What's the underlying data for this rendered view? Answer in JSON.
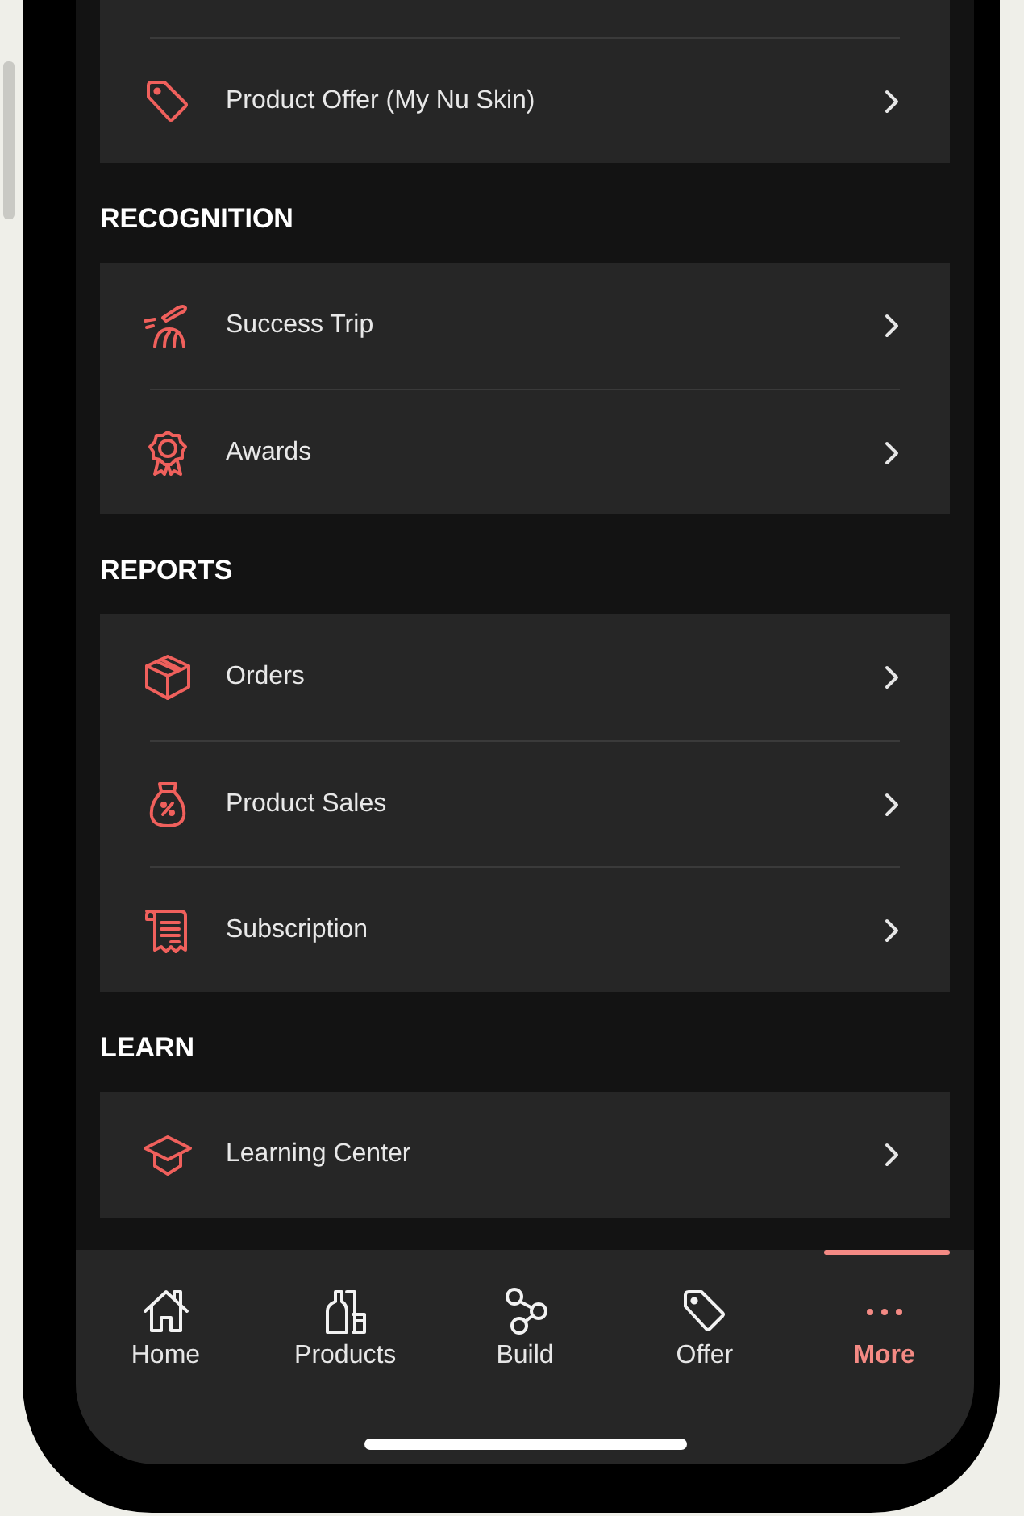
{
  "sections": [
    {
      "items": [
        {
          "label": "Product Offer (My Nu Skin)"
        }
      ]
    },
    {
      "title": "RECOGNITION",
      "items": [
        {
          "label": "Success Trip"
        },
        {
          "label": "Awards"
        }
      ]
    },
    {
      "title": "REPORTS",
      "items": [
        {
          "label": "Orders"
        },
        {
          "label": "Product Sales"
        },
        {
          "label": "Subscription"
        }
      ]
    },
    {
      "title": "LEARN",
      "items": [
        {
          "label": "Learning Center"
        }
      ]
    }
  ],
  "tab_bar": [
    {
      "label": "Home",
      "selected": false
    },
    {
      "label": "Products",
      "selected": false
    },
    {
      "label": "Build",
      "selected": false
    },
    {
      "label": "Offer",
      "selected": false
    },
    {
      "label": "More",
      "selected": true
    }
  ]
}
